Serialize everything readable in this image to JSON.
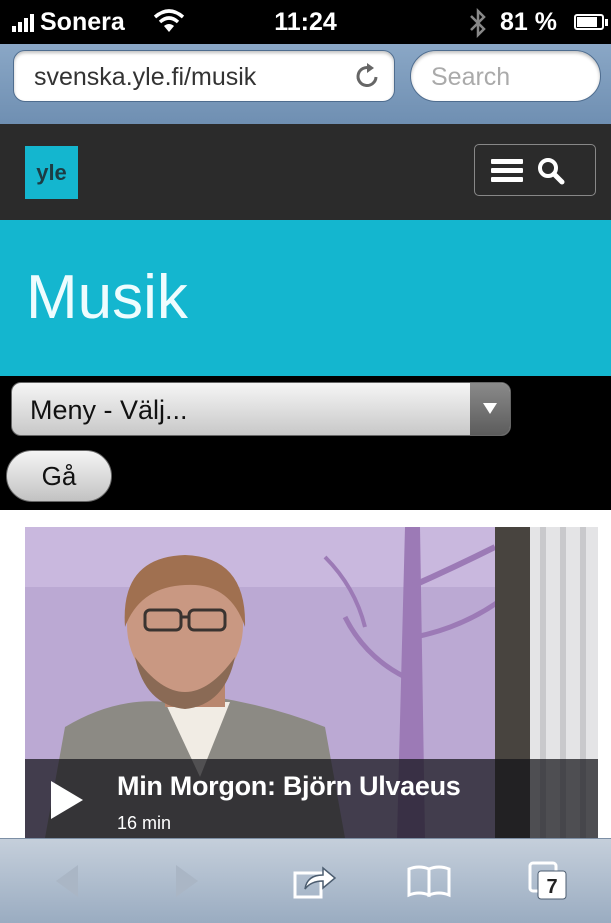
{
  "status_bar": {
    "carrier": "Sonera",
    "time": "11:24",
    "battery": "81 %",
    "icons": [
      "signal-icon",
      "wifi-icon",
      "bluetooth-icon",
      "battery-icon"
    ]
  },
  "browser": {
    "url": "svenska.yle.fi/musik",
    "search_placeholder": "Search",
    "tab_count": "7"
  },
  "site": {
    "logo_text": "yle",
    "page_title": "Musik",
    "brand_color": "#14b6cf"
  },
  "menu": {
    "select_value": "Meny - Välj...",
    "go_label": "Gå"
  },
  "video": {
    "title": "Min Morgon: Björn Ulvaeus",
    "duration": "16 min"
  },
  "toolbar": {
    "icons": [
      "back-icon",
      "forward-icon",
      "share-icon",
      "bookmarks-icon",
      "tabs-icon"
    ]
  }
}
